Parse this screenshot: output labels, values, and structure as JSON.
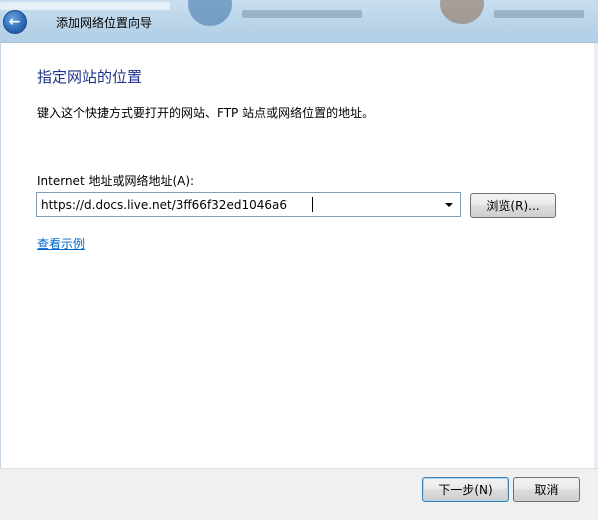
{
  "window": {
    "title": "添加网络位置向导"
  },
  "main": {
    "heading": "指定网站的位置",
    "instruction": "键入这个快捷方式要打开的网站、FTP 站点或网络位置的地址。",
    "address_label": "Internet 地址或网络地址(A):",
    "address_value": "https://d.docs.live.net/3ff66f32ed1046a6",
    "browse_label": "浏览(R)...",
    "example_link": "查看示例"
  },
  "footer": {
    "next_label": "下一步(N)",
    "cancel_label": "取消"
  },
  "icons": {
    "back": "back-arrow-icon",
    "dropdown": "chevron-down-icon"
  },
  "colors": {
    "heading": "#1e3287",
    "link": "#0066cc",
    "back_button": "#2a67b3"
  }
}
